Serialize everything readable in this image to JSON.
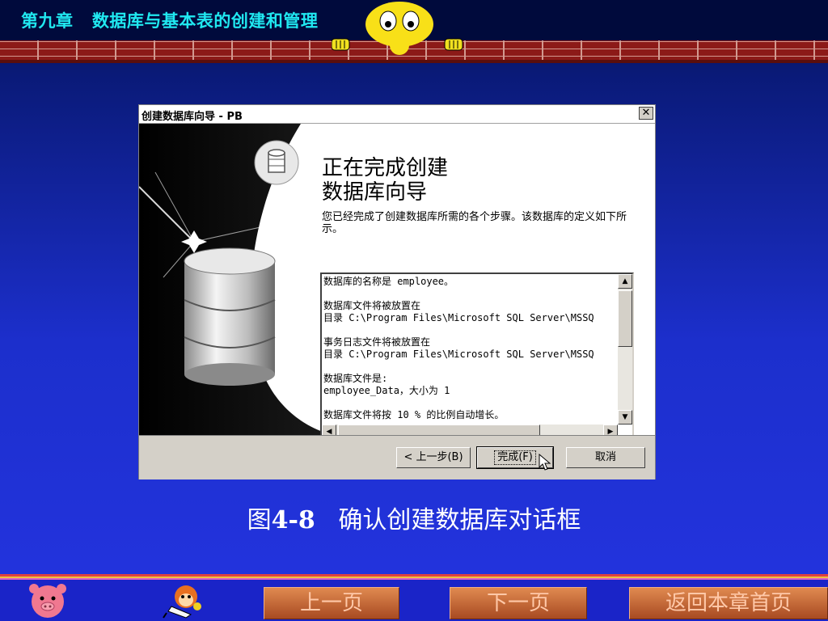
{
  "header": {
    "chapter_title": "第九章   数据库与基本表的创建和管理"
  },
  "dialog": {
    "title": "创建数据库向导 - PB",
    "close_label": "✕",
    "heading_line1": "正在完成创建",
    "heading_line2": "数据库向导",
    "intro": "您已经完成了创建数据库所需的各个步骤。该数据库的定义如下所示。",
    "summary_lines": [
      "数据库的名称是 employee。",
      "",
      "数据库文件将被放置在",
      "目录 C:\\Program Files\\Microsoft SQL Server\\MSSQ",
      "",
      "事务日志文件将被放置在",
      "目录 C:\\Program Files\\Microsoft SQL Server\\MSSQ",
      "",
      "数据库文件是:",
      "employee_Data，大小为 1",
      "",
      "数据库文件将按 10 % 的比例自动增长。"
    ],
    "buttons": {
      "back": "< 上一步(B)",
      "finish": "完成(F)",
      "cancel": "取消"
    }
  },
  "caption": {
    "prefix": "图",
    "number": "4-8",
    "text": "   确认创建数据库对话框"
  },
  "footer": {
    "prev_page": "上一页",
    "next_page": "下一页",
    "return_home": "返回本章首页"
  },
  "icons": {
    "mascot": "yellow-face-mascot",
    "pig": "pig-face-icon",
    "monkey": "monkey-icon",
    "database": "database-cylinder-icon"
  },
  "colors": {
    "chapter_title": "#20e8f0",
    "nav_button": "#c86a3a",
    "brick": "#8c1a18"
  }
}
